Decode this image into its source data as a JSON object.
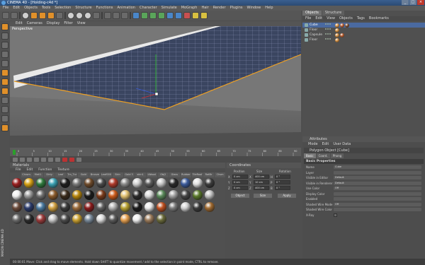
{
  "window": {
    "title": "CINEMA 4D - [Holding-c4d *]"
  },
  "menubar": [
    "File",
    "Edit",
    "Objects",
    "Tools",
    "Selection",
    "Structure",
    "Functions",
    "Animation",
    "Character",
    "Simulate",
    "MoGraph",
    "Hair",
    "Render",
    "Plugins",
    "Window",
    "Help"
  ],
  "viewport": {
    "menu": [
      "Edit",
      "Cameras",
      "Display",
      "Filter",
      "View"
    ],
    "label": "Perspective"
  },
  "timeline": {
    "ticks": [
      "0",
      "5",
      "10",
      "15",
      "20",
      "25",
      "30",
      "35",
      "40",
      "45",
      "50",
      "55",
      "60",
      "65",
      "70",
      "75",
      "80",
      "85",
      "90"
    ],
    "frame": "0 F"
  },
  "materials": {
    "panel_title": "Materials",
    "menu": [
      "File",
      "Edit",
      "Function",
      "Texture"
    ],
    "tabs": [
      "Chrom.",
      "Metl1",
      "Dirty Mel",
      "Leaf",
      "Tm_Tnr",
      "Gold",
      "Bronze",
      "Leaf000",
      "Skin",
      "Gold 3",
      "skin1",
      "LWood",
      "Obj2",
      "Glass",
      "Rubber",
      "TileRoof",
      "RatBr",
      "Chsm"
    ],
    "swatch_colors": [
      "#9a1f1f",
      "#d9a214",
      "#2f7a3c",
      "#3aa1b3",
      "#1e1e1e",
      "#7a7a7a",
      "#6e4a2a",
      "#4a4a4a",
      "#b03a2a",
      "#8a8a8a",
      "#cfcfcf",
      "#5a5a5a",
      "#c4c4c4",
      "#2a2a2a",
      "#3a5a9a",
      "#e0e0e0",
      "#3c3c3c",
      "#f0f0f0",
      "#9a9a9a",
      "#6e6e6e",
      "#8a5a2a",
      "#3a2a1a",
      "#b8860b",
      "#1a1a1a",
      "#7a3a1a",
      "#cc5a1a",
      "#e0c070",
      "#2a2a2a",
      "#d8d8d8",
      "#5a8a5a",
      "#a0a0a0",
      "#444444",
      "#5a7a2a",
      "#c0c0c0",
      "#6a4a3a",
      "#2a3a6a",
      "#4a7aa0",
      "#d0a040",
      "#3a3a3a",
      "#9a6a3a",
      "#8a1a1a",
      "#606060",
      "#b0b0b0",
      "#b6a030",
      "#1a1a1a",
      "#e8e8e8",
      "#c05020",
      "#7a7a7a",
      "#d0d0d0",
      "#3a3a3a",
      "#a06a30",
      "#6a6a6a",
      "#2a2a2a",
      "#9a3a3a",
      "#c8c8c8",
      "#4a4a4a",
      "#caa030",
      "#7a8a9a",
      "#dadada",
      "#5a5a5a",
      "#e6a050",
      "#ececec",
      "#9a7a5a",
      "#6a6a3a"
    ]
  },
  "coordinates": {
    "panel_title": "Coordinates",
    "headers": [
      "Position",
      "Size",
      "Rotation"
    ],
    "rows": [
      {
        "axis": "X",
        "pos": "0 cm",
        "size": "400 cm",
        "rot_label": "H",
        "rot": "0 °"
      },
      {
        "axis": "Y",
        "pos": "0 cm",
        "size": "10 cm",
        "rot_label": "P",
        "rot": "0 °"
      },
      {
        "axis": "Z",
        "pos": "0 cm",
        "size": "400 cm",
        "rot_label": "B",
        "rot": "0 °"
      }
    ],
    "mode_object": "Object",
    "mode_size": "Size",
    "apply": "Apply"
  },
  "objects": {
    "tabs": [
      "Objects",
      "Structure"
    ],
    "menu": [
      "File",
      "Edit",
      "View",
      "Objects",
      "Tags",
      "Bookmarks"
    ],
    "items": [
      {
        "name": "Cube",
        "selected": true
      },
      {
        "name": "Floor",
        "selected": false
      },
      {
        "name": "Capsule",
        "selected": false
      },
      {
        "name": "Floor",
        "selected": false
      }
    ]
  },
  "attributes": {
    "panel_title": "Attributes",
    "menu": [
      "Mode",
      "Edit",
      "User Data"
    ],
    "object_title": "Polygon Object [Cube]",
    "tabs": [
      "Basic",
      "Coord.",
      "Phong"
    ],
    "section": "Basic Properties",
    "fields": [
      {
        "label": "Name",
        "value": "Cube"
      },
      {
        "label": "Layer",
        "value": ""
      },
      {
        "label": "Visible in Editor",
        "value": "Default"
      },
      {
        "label": "Visible in Renderer",
        "value": "Default"
      },
      {
        "label": "Use Color",
        "value": "Off"
      },
      {
        "label": "Display Color",
        "value": ""
      },
      {
        "label": "Enabled",
        "value": ""
      },
      {
        "label": "Shaded Wire Mode",
        "value": "Off"
      },
      {
        "label": "Shaded Wire Color",
        "value": ""
      },
      {
        "label": "X-Ray",
        "value": ""
      }
    ]
  },
  "status": {
    "text": "00:00:01   Move: Click and drag to move elements. Hold down SHIFT to quantize movement / add to the selection in point mode, CTRL to remove."
  },
  "brand": "MAXON CINEMA 4D"
}
